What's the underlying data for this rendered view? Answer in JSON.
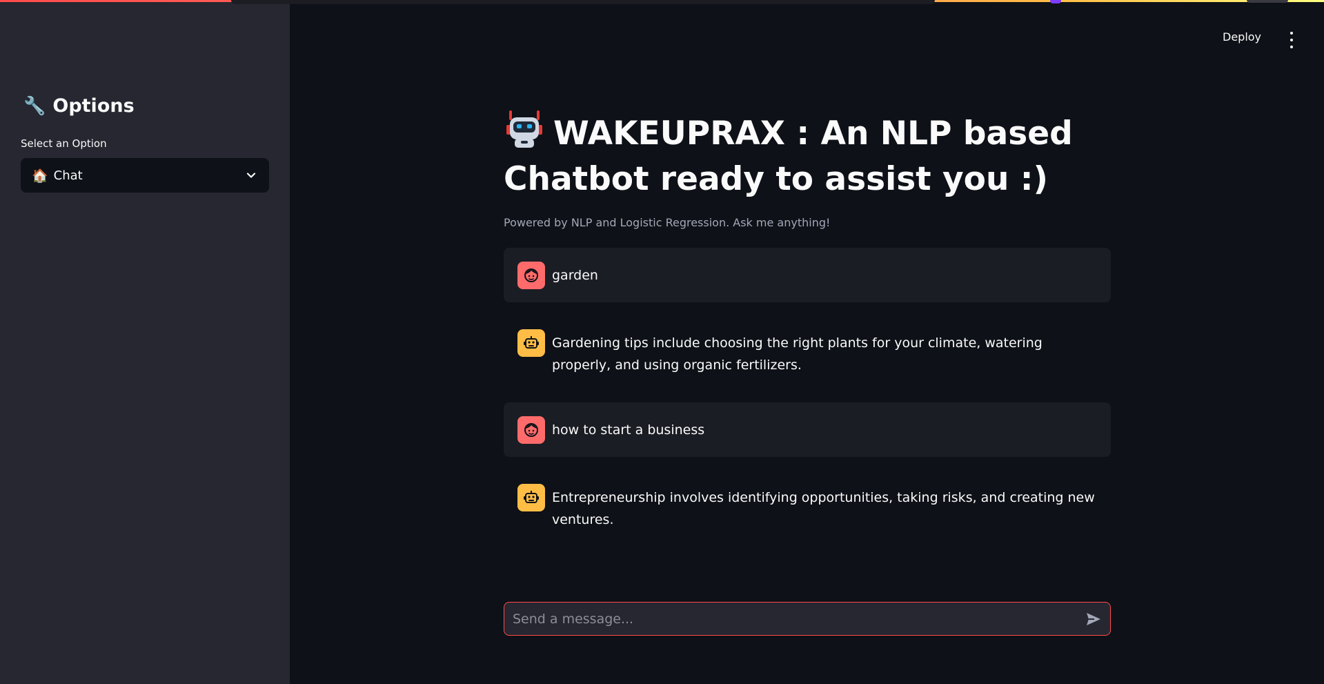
{
  "sidebar": {
    "header_icon": "wrench-icon",
    "header": "Options",
    "select_label": "Select an Option",
    "select": {
      "icon": "house-icon",
      "value": "Chat"
    }
  },
  "toolbar": {
    "deploy_label": "Deploy",
    "menu_icon": "kebab-menu-icon"
  },
  "main": {
    "title_icon": "robot-icon",
    "title": "WAKEUPRAX : An NLP based Chatbot ready to assist you :)",
    "subtitle": "Powered by NLP and Logistic Regression. Ask me anything!"
  },
  "messages": [
    {
      "role": "user",
      "avatar_icon": "user-face-icon",
      "text": "garden"
    },
    {
      "role": "assistant",
      "avatar_icon": "bot-icon",
      "text": "Gardening tips include choosing the right plants for your climate, watering properly, and using organic fertilizers."
    },
    {
      "role": "user",
      "avatar_icon": "user-face-icon",
      "text": "how to start a business"
    },
    {
      "role": "assistant",
      "avatar_icon": "bot-icon",
      "text": "Entrepreneurship involves identifying opportunities, taking risks, and creating new ventures."
    }
  ],
  "chat_input": {
    "placeholder": "Send a message...",
    "value": "",
    "send_icon": "send-icon"
  },
  "colors": {
    "background": "#0e1117",
    "sidebar": "#262730",
    "accent": "#ff4b4b",
    "user_avatar": "#ff6b6b",
    "bot_avatar": "#ffbd45"
  }
}
